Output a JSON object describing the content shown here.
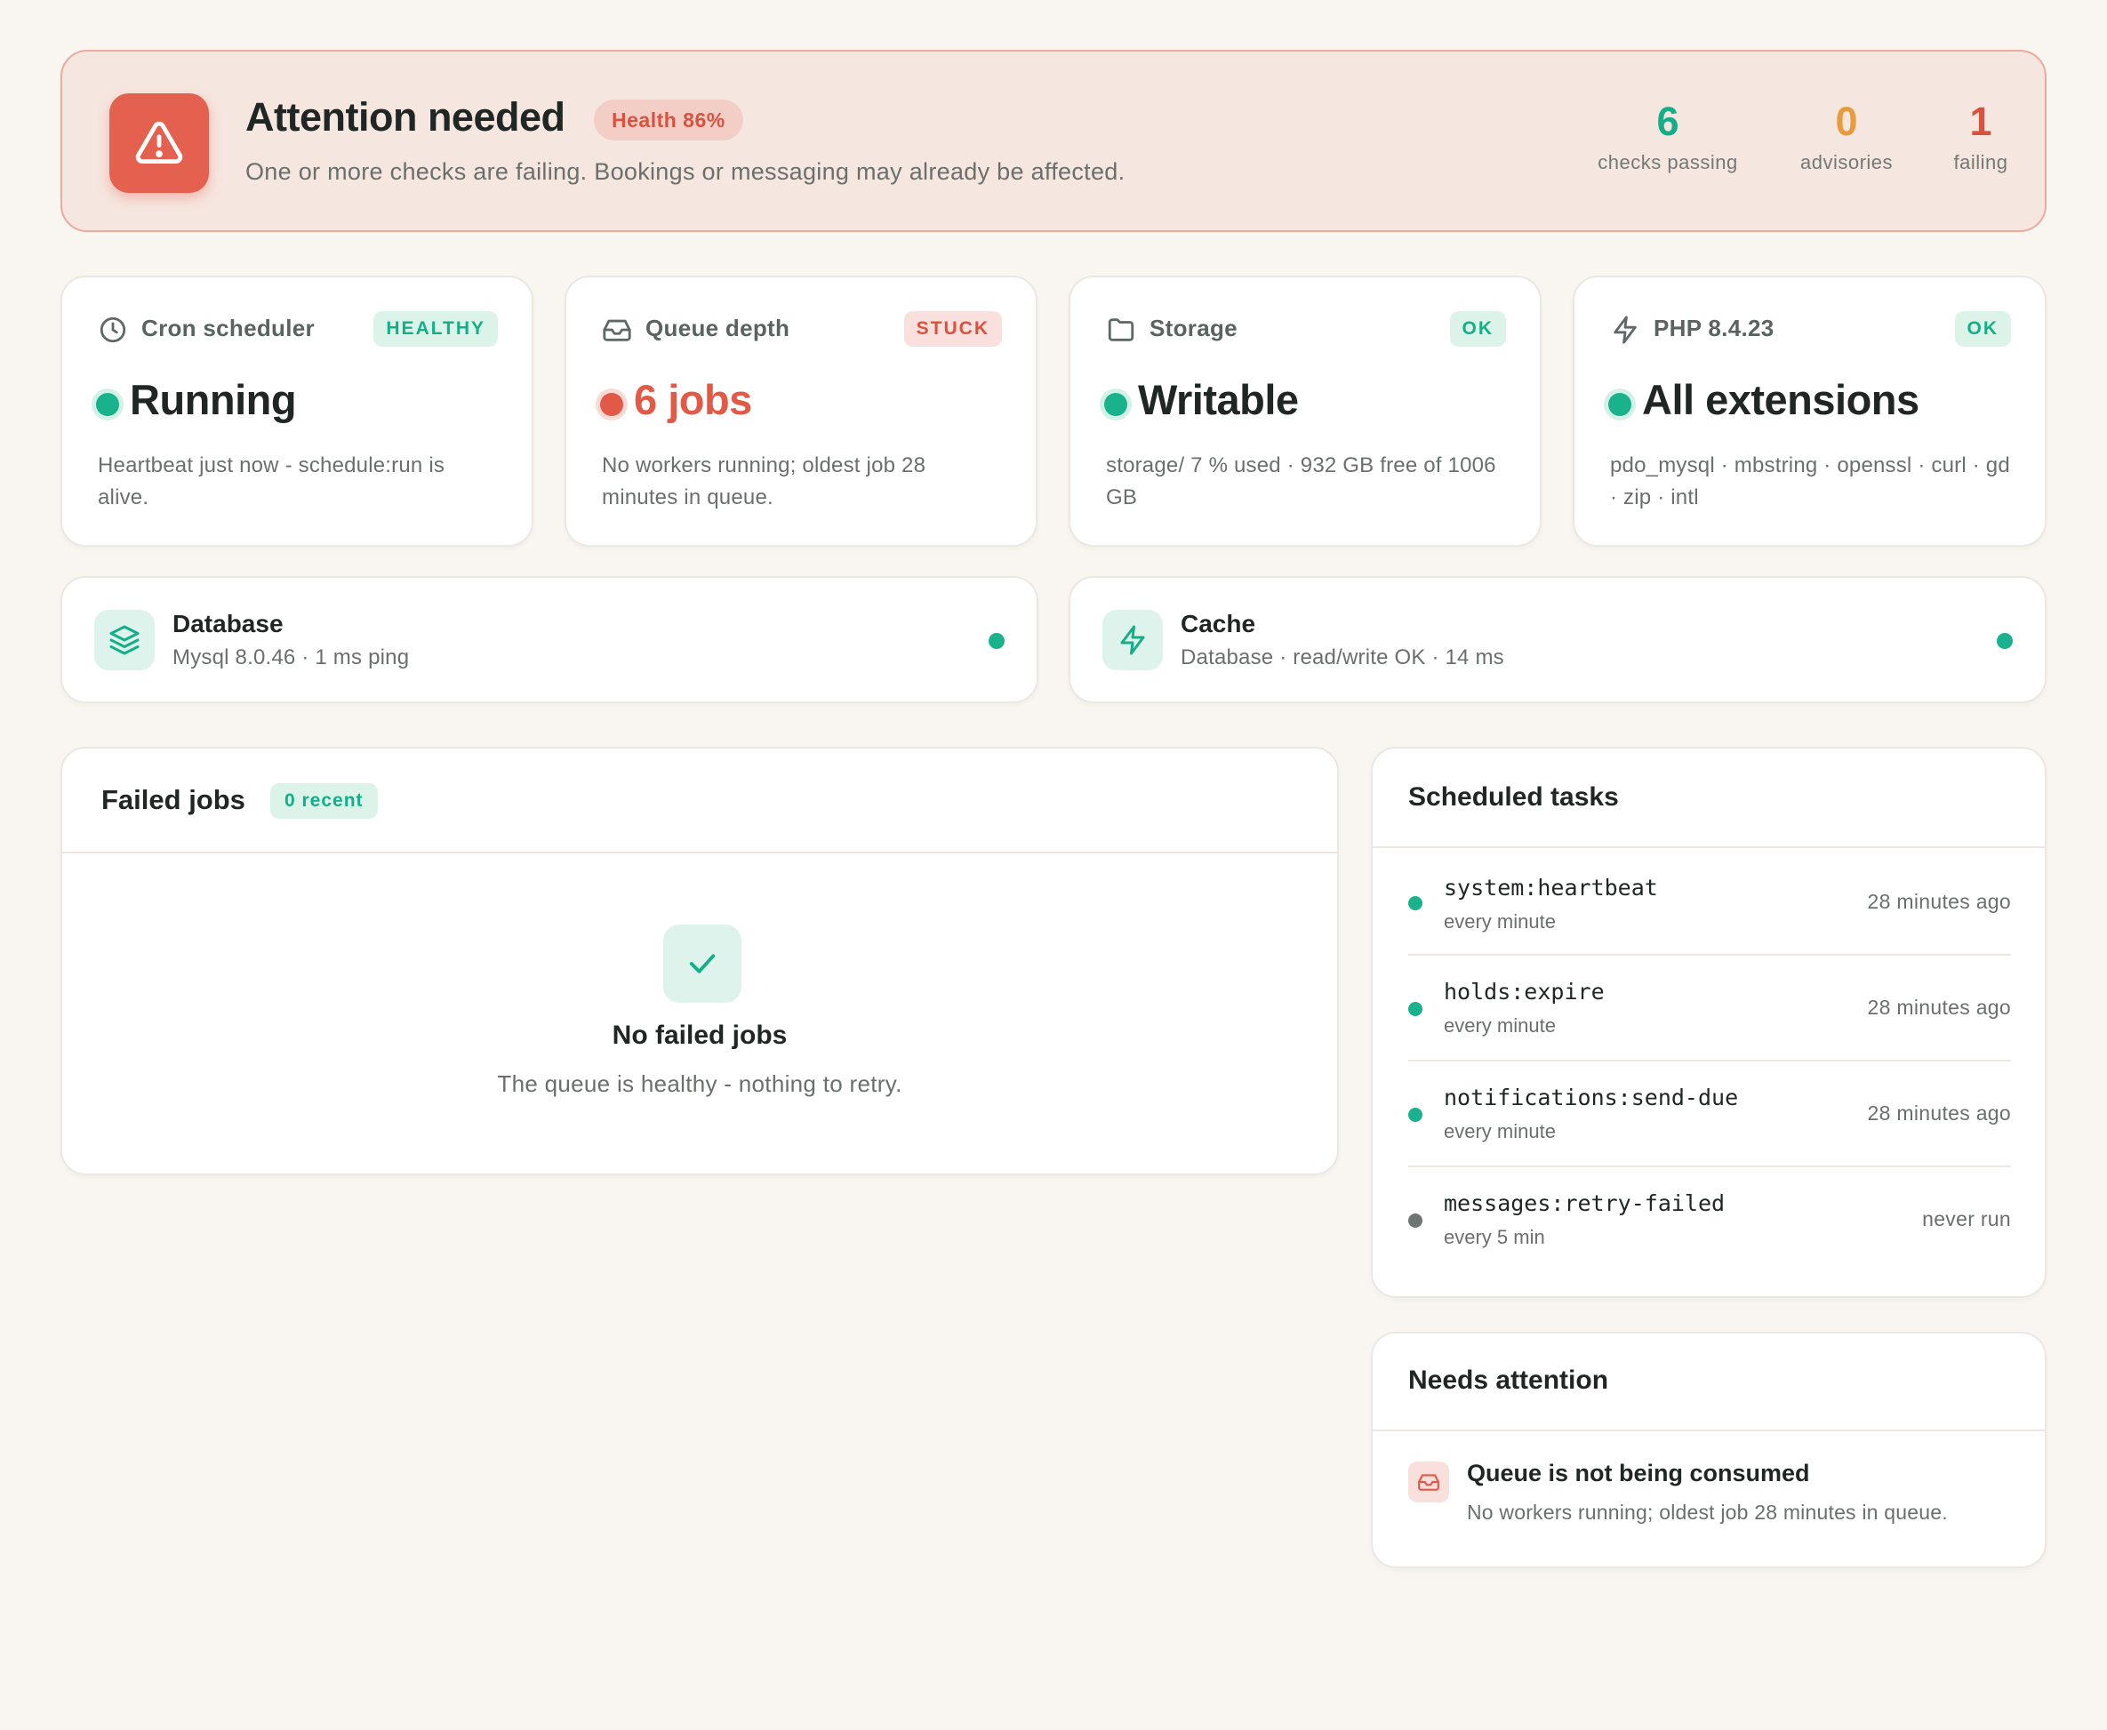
{
  "banner": {
    "title": "Attention needed",
    "health_badge": "Health 86%",
    "subtitle": "One or more checks are failing. Bookings or messaging may already be affected.",
    "stats": [
      {
        "value": "6",
        "label": "checks passing",
        "color": "#14ae88"
      },
      {
        "value": "0",
        "label": "advisories",
        "color": "#e99a3a"
      },
      {
        "value": "1",
        "label": "failing",
        "color": "#d9523f"
      }
    ]
  },
  "cards": [
    {
      "icon": "clock-icon",
      "label": "Cron scheduler",
      "badge": "HEALTHY",
      "status": "healthy",
      "value": "Running",
      "desc": "Heartbeat just now - schedule:run is alive."
    },
    {
      "icon": "inbox-icon",
      "label": "Queue depth",
      "badge": "STUCK",
      "status": "stuck",
      "value": "6 jobs",
      "desc": "No workers running; oldest job 28 minutes in queue."
    },
    {
      "icon": "folder-icon",
      "label": "Storage",
      "badge": "OK",
      "status": "ok",
      "value": "Writable",
      "desc": "storage/ 7 % used · 932 GB free of 1006 GB"
    },
    {
      "icon": "bolt-icon",
      "label": "PHP 8.4.23",
      "badge": "OK",
      "status": "ok",
      "value": "All extensions",
      "desc": "pdo_mysql · mbstring · openssl · curl · gd · zip · intl"
    }
  ],
  "services": [
    {
      "icon": "layers-icon",
      "title": "Database",
      "sub": "Mysql 8.0.46 · 1 ms ping"
    },
    {
      "icon": "bolt-icon",
      "title": "Cache",
      "sub": "Database · read/write OK · 14 ms"
    }
  ],
  "failed_jobs": {
    "title": "Failed jobs",
    "badge": "0 recent",
    "empty_title": "No failed jobs",
    "empty_sub": "The queue is healthy - nothing to retry."
  },
  "scheduled": {
    "title": "Scheduled tasks",
    "tasks": [
      {
        "name": "system:heartbeat",
        "freq": "every minute",
        "time": "28 minutes ago",
        "status": "ok"
      },
      {
        "name": "holds:expire",
        "freq": "every minute",
        "time": "28 minutes ago",
        "status": "ok"
      },
      {
        "name": "notifications:send-due",
        "freq": "every minute",
        "time": "28 minutes ago",
        "status": "ok"
      },
      {
        "name": "messages:retry-failed",
        "freq": "every 5 min",
        "time": "never run",
        "status": "idle"
      }
    ]
  },
  "attention": {
    "title": "Needs attention",
    "item_icon": "inbox-icon",
    "item_title": "Queue is not being consumed",
    "item_sub": "No workers running; oldest job 28 minutes in queue."
  },
  "colors": {
    "green": "#19b28d",
    "red": "#e25a47",
    "orange": "#e99a3a",
    "gray": "#6f7573",
    "background": "#f9f6f2"
  }
}
